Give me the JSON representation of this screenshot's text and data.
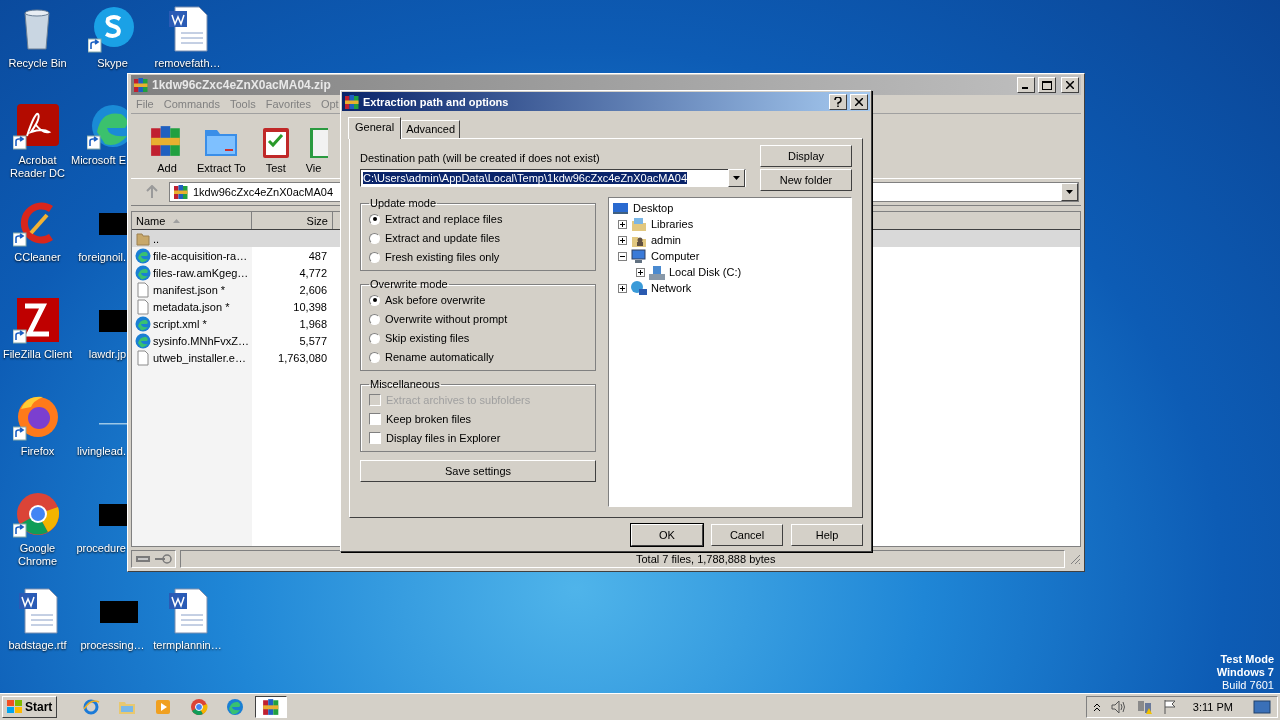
{
  "desktop_columns": [
    [
      {
        "label": "Recycle Bin",
        "kind": "recycle",
        "shortcut": false
      },
      {
        "label": "Acrobat Reader DC",
        "kind": "acrobat",
        "shortcut": true
      },
      {
        "label": "CCleaner",
        "kind": "ccleaner",
        "shortcut": true
      },
      {
        "label": "FileZilla Client",
        "kind": "filezilla",
        "shortcut": true
      },
      {
        "label": "Firefox",
        "kind": "firefox",
        "shortcut": true
      },
      {
        "label": "Google Chrome",
        "kind": "chrome",
        "shortcut": true
      },
      {
        "label": "badstage.rtf",
        "kind": "word",
        "shortcut": false
      }
    ],
    [
      {
        "label": "Skype",
        "kind": "skype",
        "shortcut": true
      },
      {
        "label": "Microsoft E",
        "kind": "edge",
        "shortcut": true
      },
      {
        "label": "foreignoil.",
        "kind": "redacted",
        "shortcut": false
      },
      {
        "label": "lawdr.jp",
        "kind": "redacted",
        "shortcut": false
      },
      {
        "label": "livinglead.",
        "kind": "blank",
        "shortcut": false
      },
      {
        "label": "procedure",
        "kind": "redacted",
        "shortcut": false
      },
      {
        "label": "processing…",
        "kind": "redacted",
        "shortcut": false
      }
    ],
    [
      {
        "label": "removefath…",
        "kind": "word",
        "shortcut": false
      },
      {
        "label": "termplannin…",
        "kind": "word",
        "shortcut": false
      }
    ]
  ],
  "archiver_window": {
    "title": "1kdw96cZxc4eZnX0acMA04.zip",
    "menu": [
      "File",
      "Commands",
      "Tools",
      "Favorites",
      "Opt"
    ],
    "toolbar": [
      {
        "label": "Add",
        "kind": "archive"
      },
      {
        "label": "Extract To",
        "kind": "folder"
      },
      {
        "label": "Test",
        "kind": "clipboard"
      },
      {
        "label": "Vie",
        "kind": "book"
      }
    ],
    "address": "1kdw96cZxc4eZnX0acMA04",
    "columns": [
      "Name",
      "Size"
    ],
    "rows": [
      {
        "name": "..",
        "size": "",
        "kind": "folder",
        "selected": true
      },
      {
        "name": "file-acquisition-ra…",
        "size": "487",
        "kind": "edge",
        "selected": false
      },
      {
        "name": "files-raw.amKgeg…",
        "size": "4,772",
        "kind": "edge",
        "selected": false
      },
      {
        "name": "manifest.json *",
        "size": "2,606",
        "kind": "file",
        "selected": false
      },
      {
        "name": "metadata.json *",
        "size": "10,398",
        "kind": "file",
        "selected": false
      },
      {
        "name": "script.xml *",
        "size": "1,968",
        "kind": "edge",
        "selected": false
      },
      {
        "name": "sysinfo.MNhFvxZ…",
        "size": "5,577",
        "kind": "edge",
        "selected": false
      },
      {
        "name": "utweb_installer.e…",
        "size": "1,763,080",
        "kind": "file",
        "selected": false
      }
    ],
    "status_bar": "Total 7 files, 1,788,888 bytes"
  },
  "dialog": {
    "title": "Extraction path and options",
    "tabs": [
      {
        "label": "General",
        "selected": true
      },
      {
        "label": "Advanced",
        "selected": false
      }
    ],
    "destination_label": "Destination path (will be created if does not exist)",
    "destination": {
      "value": "C:\\Users\\admin\\AppData\\Local\\Temp\\1kdw96cZxc4eZnX0acMA04",
      "highlighted": true
    },
    "side_buttons": [
      "Display",
      "New folder"
    ],
    "groups": [
      {
        "title": "Update mode",
        "kind": "radio",
        "options": [
          {
            "label": "Extract and replace files",
            "checked": true
          },
          {
            "label": "Extract and update files",
            "checked": false
          },
          {
            "label": "Fresh existing files only",
            "checked": false
          }
        ]
      },
      {
        "title": "Overwrite mode",
        "kind": "radio",
        "options": [
          {
            "label": "Ask before overwrite",
            "checked": true
          },
          {
            "label": "Overwrite without prompt",
            "checked": false
          },
          {
            "label": "Skip existing files",
            "checked": false
          },
          {
            "label": "Rename automatically",
            "checked": false
          }
        ]
      },
      {
        "title": "Miscellaneous",
        "kind": "checkbox",
        "options": [
          {
            "label": "Extract archives to subfolders",
            "checked": false,
            "disabled": true
          },
          {
            "label": "Keep broken files",
            "checked": false,
            "disabled": false
          },
          {
            "label": "Display files in Explorer",
            "checked": false,
            "disabled": false
          }
        ]
      }
    ],
    "save_button": "Save settings",
    "tree": [
      {
        "label": "Desktop",
        "kind": "desktop",
        "children": [
          {
            "label": "Libraries",
            "kind": "library",
            "expanded": false
          },
          {
            "label": "admin",
            "kind": "user",
            "expanded": false
          },
          {
            "label": "Computer",
            "kind": "computer",
            "expanded": true,
            "children": [
              {
                "label": "Local Disk (C:)",
                "kind": "disk",
                "expanded": false
              }
            ]
          },
          {
            "label": "Network",
            "kind": "network",
            "expanded": false
          }
        ]
      }
    ],
    "buttons": [
      {
        "label": "OK",
        "default": true
      },
      {
        "label": "Cancel",
        "default": false
      },
      {
        "label": "Help",
        "default": false
      }
    ]
  },
  "system_text": [
    "Test Mode",
    "Windows 7",
    "Build 7601"
  ],
  "taskbar": {
    "start": "Start",
    "apps": [
      {
        "kind": "ie",
        "selected": false
      },
      {
        "kind": "explorer",
        "selected": false
      },
      {
        "kind": "media",
        "selected": false
      },
      {
        "kind": "chrome",
        "selected": false
      },
      {
        "kind": "edge",
        "selected": false
      },
      {
        "kind": "archive",
        "selected": true
      }
    ],
    "clock": "3:11 PM"
  }
}
